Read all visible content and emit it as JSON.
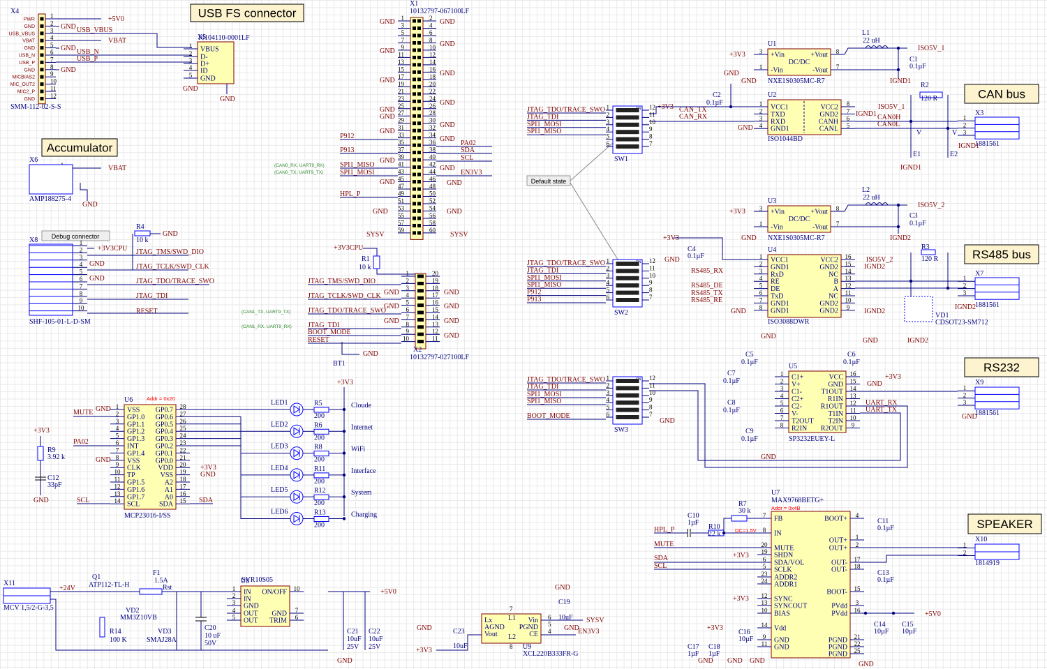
{
  "titles": {
    "usb": "USB FS connector",
    "accumulator": "Accumulator",
    "can": "CAN bus",
    "rs485": "RS485 bus",
    "rs232": "RS232",
    "speaker": "SPEAKER",
    "debug": "Debug connector",
    "default_state": "Default state"
  },
  "colors": {
    "wire": "#00007f",
    "net_label": "#800000",
    "component_fill": "#ffffb4",
    "component_border": "#800000",
    "annotation": "#ff0000",
    "note": "#2e8b2e"
  },
  "x4": {
    "ref": "X4",
    "part": "SMM-112-02-S-S",
    "pin_count": 12,
    "pins": [
      "PWR",
      "GND",
      "USB_VBUS",
      "VBAT",
      "GND",
      "USB_N",
      "USB_P",
      "GND",
      "MICBIAS2",
      "MIC_OUT2",
      "MIC2_P",
      "GND"
    ],
    "nets": [
      "+5V0",
      "GND",
      "USB_VBUS",
      "VBAT",
      "GND",
      "USB_N",
      "USB_P",
      "GND"
    ]
  },
  "x5": {
    "ref": "X5",
    "part": "10104110-0001LF",
    "left": [
      "VBUS",
      "D-",
      "D+",
      "ID",
      "GND"
    ],
    "left_num": [
      "1",
      "2",
      "3",
      "4",
      "5"
    ],
    "nets": [
      "GND",
      "GND"
    ]
  },
  "x1": {
    "ref": "X1",
    "part": "10132797-067100LF",
    "pin_count": 60,
    "left_nets": [
      "GND",
      "GND",
      "GND",
      "GND",
      "GND",
      "GND",
      "P912",
      "P913",
      "GND",
      "SPI1_MISO",
      "SPI1_MOSI",
      "GND",
      "HPL_P",
      "GND",
      "SYSV"
    ],
    "right_nets": [
      "GND",
      "GND",
      "GND",
      "GND",
      "GND",
      "GND",
      "PA02",
      "SDA",
      "SCL",
      "GND",
      "EN3V3",
      "GND",
      "GND",
      "SYSV"
    ],
    "notes": [
      "(CAN0_RX, UART9_RX)",
      "(CAN0_TX, UART9_TX)"
    ]
  },
  "x6": {
    "ref": "X6",
    "part": "AMP188275-4",
    "pin_count": 4,
    "nets": [
      "VBAT",
      "GND"
    ]
  },
  "x8": {
    "ref": "X8",
    "part": "SHF-105-01-L-D-SM",
    "pin_count": 10,
    "nets": [
      "+3V3CPU",
      "GND",
      "GND",
      "JTAG_TMS/SWD_DIO",
      "JTAG_TCLK/SWD_CLK",
      "JTAG_TDO/TRACE_SWO",
      "JTAG_TDI",
      "RESET"
    ],
    "r4": {
      "ref": "R4",
      "value": "10 k",
      "net": "GND"
    }
  },
  "x2": {
    "ref": "X2",
    "part": "10132797-027100LF",
    "pin_count": 20,
    "left_nets": [
      "JTAG_TMS/SWD_DIO",
      "JTAG_TCLK/SWD_CLK",
      "JTAG_TDO/TRACE_SWO",
      "JTAG_TDI",
      "BOOT_MODE",
      "RESET"
    ],
    "gnd": "GND",
    "power": "+3V3CPU",
    "r1": {
      "ref": "R1",
      "value": "10 k"
    },
    "bt1": "BT1",
    "notes": [
      "(CAN1_TX, UART9_TX)",
      "(CAN1_RX, UART9_RX)"
    ]
  },
  "u6": {
    "ref": "U6",
    "part": "MCP23016-I/SS",
    "addr": "Addr = 0x20",
    "left": [
      "VSS",
      "GP1.0",
      "GP1.1",
      "GP1.2",
      "GP1.3",
      "INT",
      "GP1.4",
      "VSS",
      "CLK",
      "TP",
      "GP1.5",
      "GP1.6",
      "GP1.7",
      "SCL"
    ],
    "left_num": [
      "1",
      "2",
      "3",
      "4",
      "5",
      "6",
      "7",
      "8",
      "9",
      "10",
      "11",
      "12",
      "13",
      "14"
    ],
    "right": [
      "GP0.7",
      "GP0.6",
      "GP0.5",
      "GP0.4",
      "GP0.3",
      "GP0.2",
      "GP0.1",
      "GP0.0",
      "VDD",
      "VSS",
      "A2",
      "A1",
      "A0",
      "SDA"
    ],
    "right_num": [
      "28",
      "27",
      "26",
      "25",
      "24",
      "23",
      "22",
      "21",
      "20",
      "19",
      "18",
      "17",
      "16",
      "15"
    ],
    "nets": [
      "MUTE",
      "GND",
      "PA02",
      "GND",
      "SCL",
      "+3V3",
      "GND",
      "SDA",
      "+3V3",
      "GND"
    ],
    "r9": {
      "ref": "R9",
      "value": "3.92 k"
    },
    "c12": {
      "ref": "C12",
      "value": "33pF"
    }
  },
  "leds": {
    "power": "+3V3",
    "items": [
      {
        "led": "LED1",
        "res": "R5",
        "value": "200",
        "label": "Cloude"
      },
      {
        "led": "LED2",
        "res": "R6",
        "value": "200",
        "label": "Internet"
      },
      {
        "led": "LED3",
        "res": "R8",
        "value": "200",
        "label": "WiFi"
      },
      {
        "led": "LED4",
        "res": "R11",
        "value": "200",
        "label": "Interface"
      },
      {
        "led": "LED5",
        "res": "R12",
        "value": "200",
        "label": "System"
      },
      {
        "led": "LED6",
        "res": "R13",
        "value": "200",
        "label": "Charging"
      }
    ]
  },
  "power": {
    "x11": {
      "ref": "X11",
      "part": "MCV 1,5/2-G-3,5"
    },
    "v24": "+24V",
    "q1": {
      "ref": "Q1",
      "part": "ATP112-TL-H"
    },
    "f1": {
      "ref": "F1",
      "value": "1.5A",
      "tag": "Rst"
    },
    "vd2": {
      "ref": "VD2",
      "part": "MM3Z10VB"
    },
    "r14": {
      "ref": "R14",
      "value": "100 K"
    },
    "vd3": {
      "ref": "VD3",
      "part": "SMAJ28A"
    },
    "c20": {
      "ref": "C20",
      "value": "10 uF",
      "voltage": "50V"
    },
    "u8": {
      "ref": "U8",
      "part": "SVR10S05",
      "left": [
        "IN",
        "IN",
        "GND",
        "OUT",
        "OUT"
      ],
      "left_num": [
        "1",
        "2",
        "3",
        "4",
        "5"
      ],
      "right": [
        "ON/OFF",
        "GND",
        "TRIM"
      ],
      "right_num": [
        "10",
        "7",
        "6"
      ]
    },
    "c21": {
      "ref": "C21",
      "value": "10uF",
      "voltage": "25V"
    },
    "c22": {
      "ref": "C22",
      "value": "10uF",
      "voltage": "25V"
    },
    "out": "+5V0",
    "gnd": "GND"
  },
  "u9": {
    "ref": "U9",
    "part": "XCL220B333FR-G",
    "left": [
      "Lx",
      "AGND",
      "Vout"
    ],
    "mid": [
      "L1",
      "L2"
    ],
    "mid_num": [
      "7",
      "8"
    ],
    "right": [
      "Vin",
      "PGND",
      "CE"
    ],
    "right_num": [
      "6",
      "5",
      "4"
    ],
    "c19": {
      "ref": "C19",
      "value": "10uF"
    },
    "c23": {
      "ref": "C23",
      "value": "10uF"
    },
    "nets": [
      "GND",
      "GND",
      "SYSV",
      "GND",
      "EN3V3",
      "+3V3"
    ]
  },
  "sw1": {
    "ref": "SW1",
    "on": "ON",
    "left_num": [
      "1",
      "2",
      "3",
      "4",
      "5",
      "6"
    ],
    "right_num": [
      "12",
      "11",
      "10",
      "9",
      "8",
      "7"
    ],
    "nets": [
      "JTAG_TDO/TRACE_SWO",
      "JTAG_TDI",
      "SPI1_MOSI",
      "SPI1_MISO"
    ]
  },
  "sw2": {
    "ref": "SW2",
    "on": "ON",
    "left_num": [
      "1",
      "2",
      "3",
      "4",
      "5",
      "6"
    ],
    "right_num": [
      "12",
      "11",
      "10",
      "9",
      "8",
      "7"
    ],
    "nets": [
      "JTAG_TDO/TRACE_SWO",
      "JTAG_TDI",
      "SPI1_MOSI",
      "SPI1_MISO",
      "P912",
      "P913"
    ]
  },
  "sw3": {
    "ref": "SW3",
    "on": "ON",
    "left_num": [
      "1",
      "2",
      "3",
      "4",
      "5",
      "6"
    ],
    "right_num": [
      "12",
      "11",
      "10",
      "9",
      "8",
      "7"
    ],
    "nets": [
      "JTAG_TDO/TRACE_SWO",
      "JTAG_TDI",
      "SPI1_MOSI",
      "SPI1_MISO",
      "BOOT_MODE",
      "GND"
    ]
  },
  "can": {
    "u1": {
      "ref": "U1",
      "part": "NXE1S0305MC-R7",
      "left": [
        "+Vin",
        "-Vin"
      ],
      "left_num": [
        "3",
        "1"
      ],
      "right": [
        "+Vout",
        "-Vout"
      ],
      "right_num": [
        "8",
        "7"
      ],
      "center": "DC/DC"
    },
    "l1": {
      "ref": "L1",
      "value": "22 uH"
    },
    "c1": {
      "ref": "C1",
      "value": "0.1µF"
    },
    "c2": {
      "ref": "C2",
      "value": "0.1µF"
    },
    "u2": {
      "ref": "U2",
      "part": "ISO1044BD",
      "left": [
        "VCC1",
        "TXD",
        "RXD",
        "GND1"
      ],
      "left_num": [
        "1",
        "2",
        "3",
        "4"
      ],
      "right": [
        "VCC2",
        "GND2",
        "CANH",
        "CANL"
      ],
      "right_num": [
        "8",
        "7",
        "6",
        "5"
      ]
    },
    "r2": {
      "ref": "R2",
      "value": "120 R"
    },
    "e1": "E1",
    "e2": "E2",
    "v": "V",
    "x3": {
      "ref": "X3",
      "part": "1881561",
      "pin_count": 3
    },
    "nets": [
      "+3V3",
      "GND",
      "GND",
      "ISO5V_1",
      "IGND1",
      "+3V3",
      "CAN_TX",
      "CAN_RX",
      "GND",
      "ISO5V_1",
      "IGND1",
      "CAN0H",
      "CAN0L",
      "IGND1",
      "IGND1"
    ]
  },
  "rs485": {
    "u3": {
      "ref": "U3",
      "part": "NXE1S0305MC-R7",
      "left": [
        "+Vin",
        "-Vin"
      ],
      "left_num": [
        "3",
        "1"
      ],
      "right": [
        "+Vout",
        "-Vout"
      ],
      "right_num": [
        "8",
        "7"
      ],
      "center": "DC/DC"
    },
    "l2": {
      "ref": "L2",
      "value": "22 uH"
    },
    "c3": {
      "ref": "C3",
      "value": "0.1µF"
    },
    "c4": {
      "ref": "C4",
      "value": "0.1µF"
    },
    "u4": {
      "ref": "U4",
      "part": "ISO3088DWR",
      "left": [
        "VCC1",
        "GND1",
        "RxD",
        "RE",
        "DE",
        "TxD",
        "GND1",
        "GND1"
      ],
      "left_num": [
        "1",
        "2",
        "3",
        "4",
        "5",
        "6",
        "7",
        "8"
      ],
      "right": [
        "VCC2",
        "GND2",
        "NC",
        "B",
        "A",
        "NC",
        "GND2",
        "GND2"
      ],
      "right_num": [
        "16",
        "15",
        "14",
        "13",
        "12",
        "11",
        "10",
        "9"
      ]
    },
    "r3": {
      "ref": "R3",
      "value": "120 R"
    },
    "vd1": {
      "ref": "VD1",
      "part": "CDSOT23-SM712"
    },
    "x7": {
      "ref": "X7",
      "part": "1881561",
      "pin_count": 3
    },
    "nets": [
      "+3V3",
      "GND",
      "ISO5V_2",
      "IGND2",
      "+3V3",
      "GND",
      "RS485_RX",
      "RS485_DE",
      "RS485_TX",
      "RS485_RE",
      "GND",
      "ISO5V_2",
      "IGND2",
      "IGND2",
      "IGND2",
      "IGND2"
    ]
  },
  "rs232": {
    "u5": {
      "ref": "U5",
      "part": "SP3232EUEY-L",
      "left": [
        "C1+",
        "V+",
        "C1-",
        "C2+",
        "C2-",
        "V-",
        "T2OUT",
        "R2IN"
      ],
      "left_num": [
        "1",
        "2",
        "3",
        "4",
        "5",
        "6",
        "7",
        "8"
      ],
      "right": [
        "VCC",
        "GND",
        "T1OUT",
        "R1IN",
        "R1OUT",
        "T1IN",
        "T2IN",
        "R2OUT"
      ],
      "right_num": [
        "16",
        "15",
        "14",
        "13",
        "12",
        "11",
        "10",
        "9"
      ]
    },
    "c5": {
      "ref": "C5",
      "value": "0.1µF"
    },
    "c6": {
      "ref": "C6",
      "value": "0.1µF"
    },
    "c7": {
      "ref": "C7",
      "value": "0.1µF"
    },
    "c8": {
      "ref": "C8",
      "value": "0.1µF"
    },
    "c9": {
      "ref": "C9",
      "value": "0.1µF"
    },
    "x9": {
      "ref": "X9",
      "part": "1881561",
      "pin_count": 3
    },
    "nets": [
      "GND",
      "GND",
      "+3V3",
      "GND",
      "GND",
      "UART_RX",
      "UART_TX",
      "GND"
    ]
  },
  "speaker": {
    "u7": {
      "ref": "U7",
      "part": "MAX9768BETG+",
      "addr": "Addr = 0x4B",
      "left": [
        "FB",
        "IN",
        "MUTE",
        "SHDN",
        "SDA/VOL",
        "SCLK",
        "ADDR2",
        "ADDR1",
        "SYNC",
        "SYNCOUT",
        "BIAS",
        "Vdd",
        "GND",
        "GND"
      ],
      "left_num": [
        "7",
        "8",
        "20",
        "19",
        "6",
        "5",
        "23",
        "24",
        "12",
        "13",
        "10",
        "14",
        "9",
        "11"
      ],
      "right": [
        "BOOT+",
        "OUT+",
        "OUT+",
        "OUT-",
        "OUT-",
        "BOOT-",
        "PVdd",
        "PVdd",
        "PGND",
        "PGND",
        "PGND"
      ],
      "right_num": [
        "4",
        "1",
        "2",
        "17",
        "18",
        "15",
        "3",
        "16",
        "21",
        "22",
        "25"
      ]
    },
    "c10": {
      "ref": "C10",
      "value": "1µF"
    },
    "r10": {
      "ref": "R10",
      "value": "22 k"
    },
    "r7": {
      "ref": "R7",
      "value": "30 k"
    },
    "dc": "DC=1.5V",
    "c11": {
      "ref": "C11",
      "value": "0.1µF"
    },
    "c13": {
      "ref": "C13",
      "value": "0.1µF"
    },
    "c14": {
      "ref": "C14",
      "value": "10µF"
    },
    "c15": {
      "ref": "C15",
      "value": "10µF"
    },
    "c16": {
      "ref": "C16",
      "value": "10µF"
    },
    "c17": {
      "ref": "C17",
      "value": "1µF"
    },
    "c18": {
      "ref": "C18",
      "value": "1µF"
    },
    "x10": {
      "ref": "X10",
      "part": "1814919",
      "pin_count": 2
    },
    "nets": [
      "HPL_P",
      "MUTE",
      "SDA",
      "SCL",
      "+3V3",
      "+3V3",
      "+3V3",
      "+5V0",
      "GND",
      "GND",
      "GND",
      "GND"
    ]
  }
}
